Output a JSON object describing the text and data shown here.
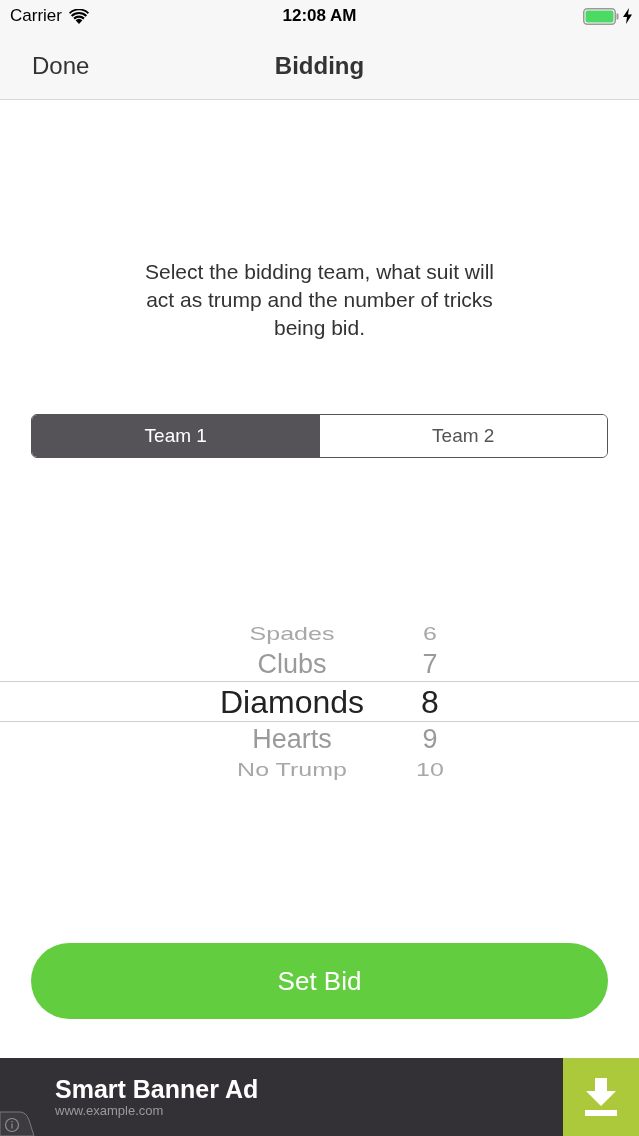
{
  "status_bar": {
    "carrier": "Carrier",
    "time": "12:08 AM"
  },
  "nav_bar": {
    "left_button": "Done",
    "title": "Bidding"
  },
  "instructions": "Select the bidding team, what suit will act as trump and the number of tricks being bid.",
  "team_selector": [
    {
      "label": "Team 1",
      "selected": true
    },
    {
      "label": "Team 2",
      "selected": false
    }
  ],
  "picker": {
    "columns": [
      {
        "options": [
          {
            "label": "Spades",
            "selected": false
          },
          {
            "label": "Clubs",
            "selected": false
          },
          {
            "label": "Diamonds",
            "selected": true
          },
          {
            "label": "Hearts",
            "selected": false
          },
          {
            "label": "No Trump",
            "selected": false
          }
        ]
      },
      {
        "options": [
          {
            "label": "6",
            "selected": false
          },
          {
            "label": "7",
            "selected": false
          },
          {
            "label": "8",
            "selected": true
          },
          {
            "label": "9",
            "selected": false
          },
          {
            "label": "10",
            "selected": false
          }
        ]
      }
    ]
  },
  "primary_button": "Set Bid",
  "ad_banner": {
    "title": "Smart Banner Ad",
    "url": "www.example.com"
  }
}
